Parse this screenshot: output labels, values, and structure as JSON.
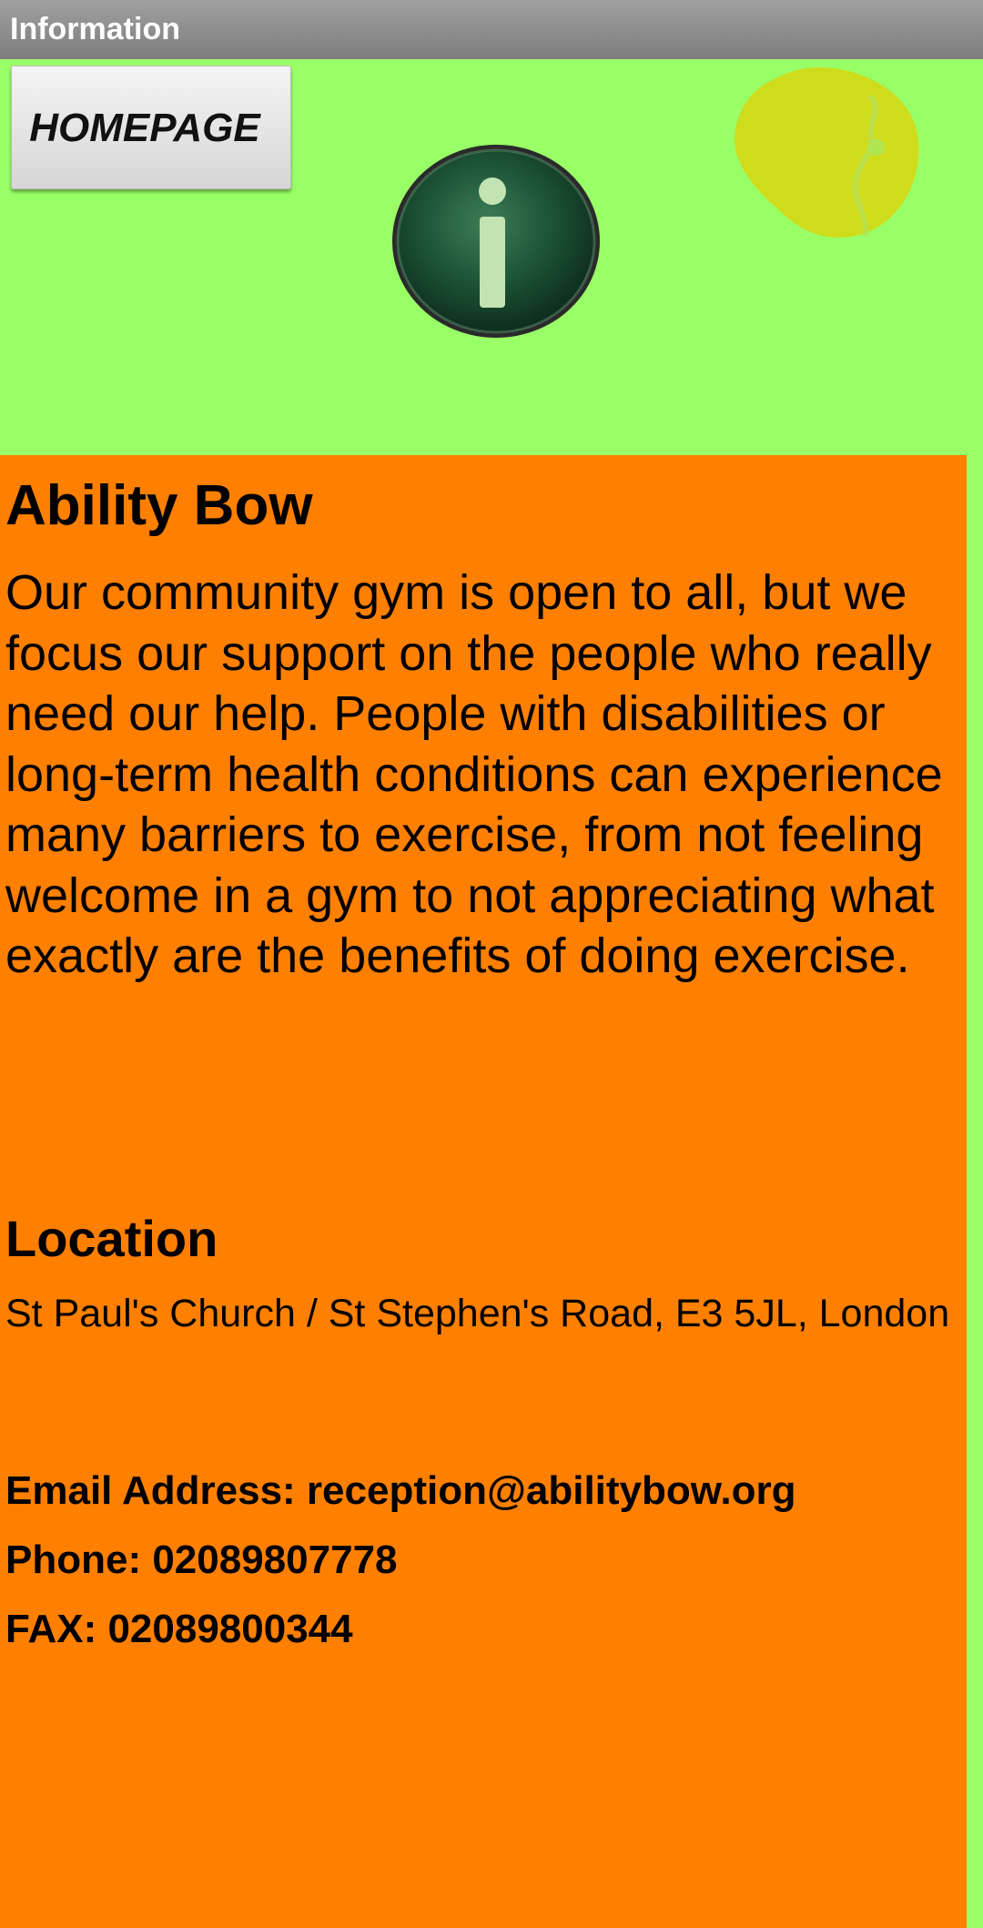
{
  "window": {
    "title": "Information"
  },
  "toolbar": {
    "home_label": "HOMEPAGE"
  },
  "icons": {
    "info": "info-icon",
    "logo": "ability-bow-logo-icon"
  },
  "colors": {
    "background": "#99ff66",
    "panel": "#ff8000",
    "title_bar": "#8a8a8a",
    "logo": "#cfdc1c",
    "info_icon": "#1f5a3a"
  },
  "main": {
    "title": "Ability Bow",
    "intro": "Our community gym is open to all, but we focus our support on the people who really need our help. People with disabilities or long-term health conditions can experience many barriers to exercise, from not feeling welcome in a gym to not appreciating what exactly are the benefits of doing exercise.",
    "location_title": "Location",
    "address": "St Paul's Church / St Stephen's Road, E3 5JL, London",
    "email_line": "Email Address: reception@abilitybow.org",
    "phone_line": "Phone: 02089807778",
    "fax_line": "FAX: 02089800344"
  }
}
